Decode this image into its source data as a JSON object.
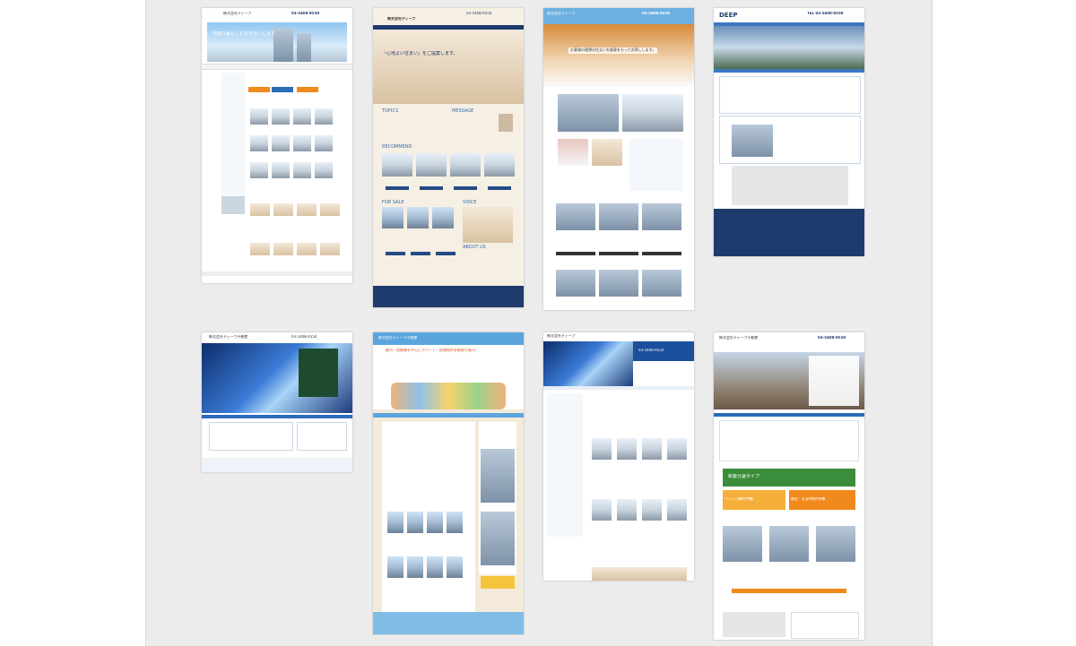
{
  "gallery": {
    "thumbnails": [
      {
        "id": "t1",
        "company": "株式会社ディープ",
        "phone": "03-5408-9550",
        "hero": "快適な暮らしをお手伝いします"
      },
      {
        "id": "t2",
        "company": "株式会社ディープ",
        "phone": "03-5408-9550",
        "hero": "「心地よい住まい」をご提案します。",
        "sections": [
          "TOPICS",
          "MESSAGE",
          "RECOMMEND",
          "FOR SALE",
          "VOICE",
          "ABOUT US"
        ]
      },
      {
        "id": "t3",
        "company": "株式会社ディープ",
        "phone": "03-5408-9550",
        "hero": "お客様の理想の住まいを誠意をもってお探しします。"
      },
      {
        "id": "t4",
        "company": "DEEP",
        "phone": "TEL 03-5408-9550"
      },
      {
        "id": "t5",
        "company": "株式会社ディープ不動産",
        "phone": "03-5408-9550"
      },
      {
        "id": "t6",
        "company": "株式会社ディープ不動産",
        "hero": "都内・首都圏を中心にアパート・賃貸物件多数取り揃え!"
      },
      {
        "id": "t7",
        "company": "株式会社ディープ",
        "phone": "03-5408-9550"
      },
      {
        "id": "t8",
        "company": "株式会社ディープ不動産",
        "phone": "03-5408-9550",
        "banners": [
          "新築分譲タイプ",
          "ペット可物件特集",
          "敷金・礼金0物件特集"
        ]
      }
    ]
  },
  "colors": {
    "panel": "#ececec",
    "navy": "#1f3b6e",
    "accent_orange": "#f08a1c",
    "blue": "#2b6cb5"
  }
}
